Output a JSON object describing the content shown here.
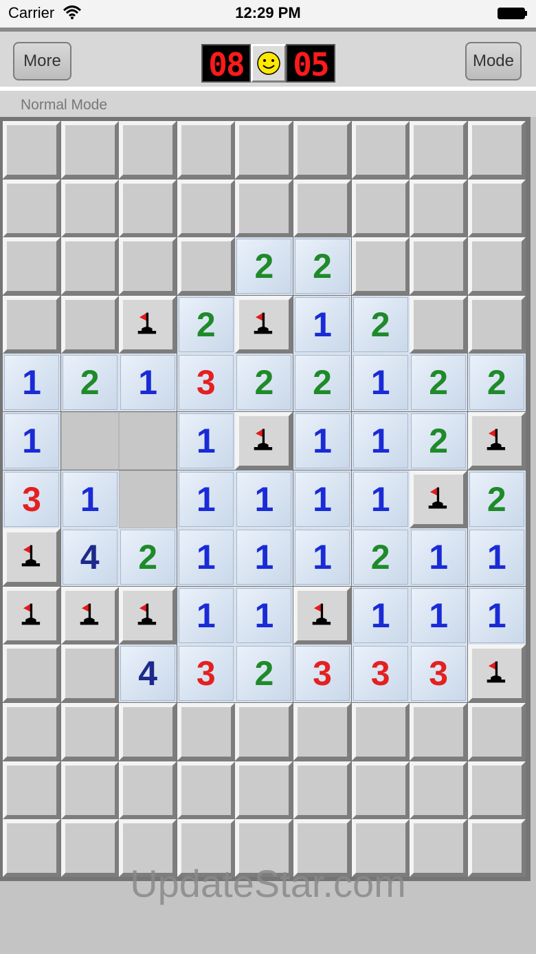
{
  "status": {
    "carrier": "Carrier",
    "time": "12:29 PM"
  },
  "toolbar": {
    "more_label": "More",
    "mode_label": "Mode",
    "mines_counter": "08",
    "timer": "05"
  },
  "mode_text": "Normal Mode",
  "watermark": "UpdateStar.com",
  "colors": {
    "1": "#1a2bd6",
    "2": "#1f8a2a",
    "3": "#e42020",
    "4": "#1d2a8a"
  },
  "board": {
    "rows": [
      [
        "H",
        "H",
        "H",
        "H",
        "H",
        "H",
        "H",
        "H",
        "H"
      ],
      [
        "H",
        "H",
        "H",
        "H",
        "H",
        "H",
        "H",
        "H",
        "H"
      ],
      [
        "H",
        "H",
        "H",
        "H",
        "2",
        "2",
        "H",
        "H",
        "H"
      ],
      [
        "H",
        "H",
        "F",
        "2",
        "F",
        "1",
        "2",
        "H",
        "H"
      ],
      [
        "1",
        "2",
        "1",
        "3",
        "2",
        "2",
        "1",
        "2",
        "2"
      ],
      [
        "1",
        "E",
        "E",
        "1",
        "F",
        "1",
        "1",
        "2",
        "F"
      ],
      [
        "3",
        "1",
        "E",
        "1",
        "1",
        "1",
        "1",
        "F",
        "2"
      ],
      [
        "F",
        "4",
        "2",
        "1",
        "1",
        "1",
        "2",
        "1",
        "1"
      ],
      [
        "F",
        "F",
        "F",
        "1",
        "1",
        "F",
        "1",
        "1",
        "1"
      ],
      [
        "H",
        "H",
        "4",
        "3",
        "2",
        "3",
        "3",
        "3",
        "F"
      ],
      [
        "H",
        "H",
        "H",
        "H",
        "H",
        "H",
        "H",
        "H",
        "H"
      ],
      [
        "H",
        "H",
        "H",
        "H",
        "H",
        "H",
        "H",
        "H",
        "H"
      ],
      [
        "H",
        "H",
        "H",
        "H",
        "H",
        "H",
        "H",
        "H",
        "H"
      ]
    ]
  }
}
